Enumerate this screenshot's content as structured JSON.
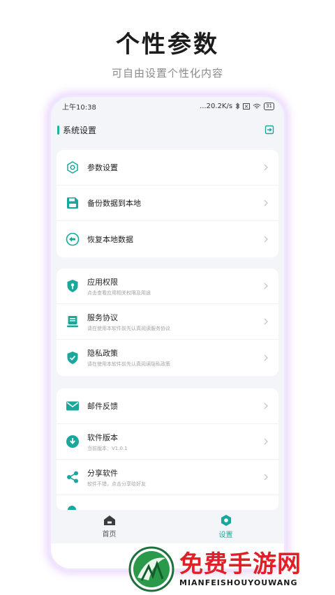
{
  "promo": {
    "title": "个性参数",
    "subtitle": "可自由设置个性化内容"
  },
  "status_bar": {
    "time": "上午10:38",
    "network_speed": "...20.2K/s",
    "battery": "31"
  },
  "app_bar": {
    "title": "系统设置",
    "exit_icon": "exit-icon"
  },
  "sections": [
    {
      "items": [
        {
          "label": "参数设置",
          "desc": "",
          "icon": "hexagon-settings-icon"
        },
        {
          "label": "备份数据到本地",
          "desc": "",
          "icon": "floppy-save-icon"
        },
        {
          "label": "恢复本地数据",
          "desc": "",
          "icon": "restore-arrow-icon"
        }
      ]
    },
    {
      "items": [
        {
          "label": "应用权限",
          "desc": "点击查看应用相关权限及用途",
          "icon": "shield-key-icon"
        },
        {
          "label": "服务协议",
          "desc": "请在使用本软件前先认真阅读服务协议",
          "icon": "document-icon"
        },
        {
          "label": "隐私政策",
          "desc": "请在使用本软件前先认真阅读隐私政策",
          "icon": "shield-check-icon"
        }
      ]
    },
    {
      "items": [
        {
          "label": "邮件反馈",
          "desc": "",
          "icon": "mail-icon"
        },
        {
          "label": "软件版本",
          "desc": "当前版本：V1.0.1",
          "icon": "download-circle-icon"
        },
        {
          "label": "分享软件",
          "desc": "软件不错，点击分享给好友",
          "icon": "share-icon"
        }
      ]
    }
  ],
  "bottom_nav": [
    {
      "label": "首页",
      "icon": "home-icon",
      "active": false
    },
    {
      "label": "设置",
      "icon": "settings-icon",
      "active": true
    }
  ],
  "watermark": {
    "cn": "免费手游网",
    "en": "MIANFEISHOUYOUWANG"
  },
  "colors": {
    "accent": "#1aa89d",
    "watermark_red": "#e01f26"
  }
}
